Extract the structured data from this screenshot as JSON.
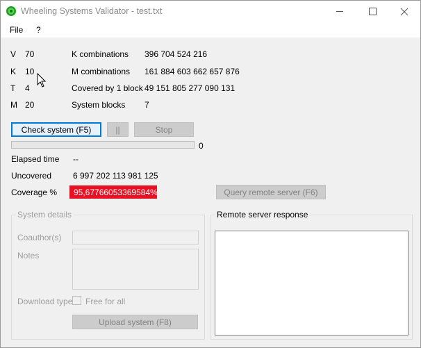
{
  "window": {
    "title": "Wheeling Systems Validator - test.txt",
    "minimize": "—",
    "maximize": "☐",
    "close": "✕"
  },
  "menu": {
    "file": "File",
    "help": "?"
  },
  "params": [
    {
      "name": "V",
      "value": "70"
    },
    {
      "name": "K",
      "value": "10"
    },
    {
      "name": "T",
      "value": "4"
    },
    {
      "name": "M",
      "value": "20"
    }
  ],
  "stats": [
    {
      "label": "K combinations",
      "value": "396 704 524 216"
    },
    {
      "label": "M combinations",
      "value": "161 884 603 662 657 876"
    },
    {
      "label": "Covered by 1 block",
      "value": "49 151 805 277 090 131"
    },
    {
      "label": "System blocks",
      "value": "7"
    }
  ],
  "buttons": {
    "check": "Check system (F5)",
    "pause": "||",
    "stop": "Stop",
    "query": "Query remote server (F6)",
    "upload": "Upload system (F8)"
  },
  "progress": {
    "value_label": "0",
    "fraction": 0
  },
  "results": {
    "elapsed_label": "Elapsed time",
    "elapsed_value": "--",
    "uncovered_label": "Uncovered",
    "uncovered_value": "6 997 202 113 981 125",
    "coverage_label": "Coverage %",
    "coverage_value": "95,67766053369584%"
  },
  "system_details": {
    "title": "System details",
    "coauthor_label": "Coauthor(s)",
    "notes_label": "Notes",
    "download_label": "Download type",
    "free_label": "Free for all"
  },
  "remote": {
    "title": "Remote server response"
  },
  "colors": {
    "accent": "#0078d7",
    "coverage_bg": "#e81123",
    "progress": "#06b025"
  }
}
